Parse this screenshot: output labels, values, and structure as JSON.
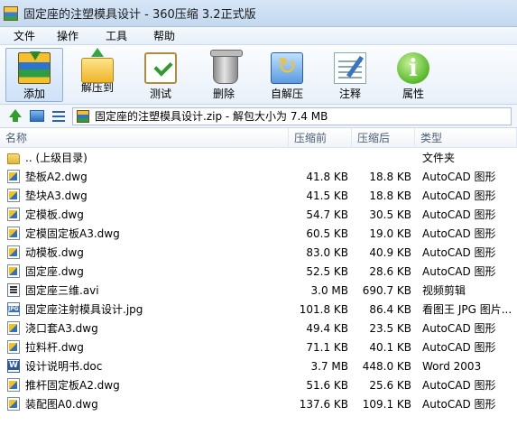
{
  "window": {
    "title": "固定座的注塑模具设计 - 360压缩 3.2正式版"
  },
  "menu": [
    "文件",
    "操作",
    "工具",
    "帮助"
  ],
  "toolbar": [
    {
      "label": "添加",
      "icon": "add-archive-icon",
      "active": true
    },
    {
      "label": "解压到",
      "icon": "extract-to-icon"
    },
    {
      "label": "测试",
      "icon": "test-icon"
    },
    {
      "label": "删除",
      "icon": "delete-icon"
    },
    {
      "label": "自解压",
      "icon": "sfx-icon"
    },
    {
      "label": "注释",
      "icon": "comment-icon"
    },
    {
      "label": "属性",
      "icon": "properties-icon"
    }
  ],
  "address": {
    "text": "固定座的注塑模具设计.zip - 解包大小为 7.4 MB"
  },
  "columns": {
    "name": "名称",
    "compressed": "压缩前",
    "original": "压缩后",
    "type": "类型"
  },
  "files": [
    {
      "name": ".. (上级目录)",
      "compressed": "",
      "original": "",
      "type": "文件夹",
      "icon": "folder"
    },
    {
      "name": "垫板A2.dwg",
      "compressed": "41.8 KB",
      "original": "18.8 KB",
      "type": "AutoCAD 图形",
      "icon": "dwg"
    },
    {
      "name": "垫块A3.dwg",
      "compressed": "41.5 KB",
      "original": "18.8 KB",
      "type": "AutoCAD 图形",
      "icon": "dwg"
    },
    {
      "name": "定模板.dwg",
      "compressed": "54.7 KB",
      "original": "30.5 KB",
      "type": "AutoCAD 图形",
      "icon": "dwg"
    },
    {
      "name": "定模固定板A3.dwg",
      "compressed": "60.5 KB",
      "original": "19.0 KB",
      "type": "AutoCAD 图形",
      "icon": "dwg"
    },
    {
      "name": "动模板.dwg",
      "compressed": "83.0 KB",
      "original": "40.9 KB",
      "type": "AutoCAD 图形",
      "icon": "dwg"
    },
    {
      "name": "固定座.dwg",
      "compressed": "52.5 KB",
      "original": "28.6 KB",
      "type": "AutoCAD 图形",
      "icon": "dwg"
    },
    {
      "name": "固定座三维.avi",
      "compressed": "3.0 MB",
      "original": "690.7 KB",
      "type": "视频剪辑",
      "icon": "avi"
    },
    {
      "name": "固定座注射模具设计.jpg",
      "compressed": "101.8 KB",
      "original": "86.4 KB",
      "type": "看图王 JPG 图片...",
      "icon": "jpg"
    },
    {
      "name": "浇口套A3.dwg",
      "compressed": "49.4 KB",
      "original": "23.5 KB",
      "type": "AutoCAD 图形",
      "icon": "dwg"
    },
    {
      "name": "拉料杆.dwg",
      "compressed": "71.1 KB",
      "original": "40.1 KB",
      "type": "AutoCAD 图形",
      "icon": "dwg"
    },
    {
      "name": "设计说明书.doc",
      "compressed": "3.7 MB",
      "original": "448.0 KB",
      "type": "Word 2003",
      "icon": "doc"
    },
    {
      "name": "推杆固定板A2.dwg",
      "compressed": "51.6 KB",
      "original": "25.6 KB",
      "type": "AutoCAD 图形",
      "icon": "dwg"
    },
    {
      "name": "装配图A0.dwg",
      "compressed": "137.6 KB",
      "original": "109.1 KB",
      "type": "AutoCAD 图形",
      "icon": "dwg"
    }
  ]
}
